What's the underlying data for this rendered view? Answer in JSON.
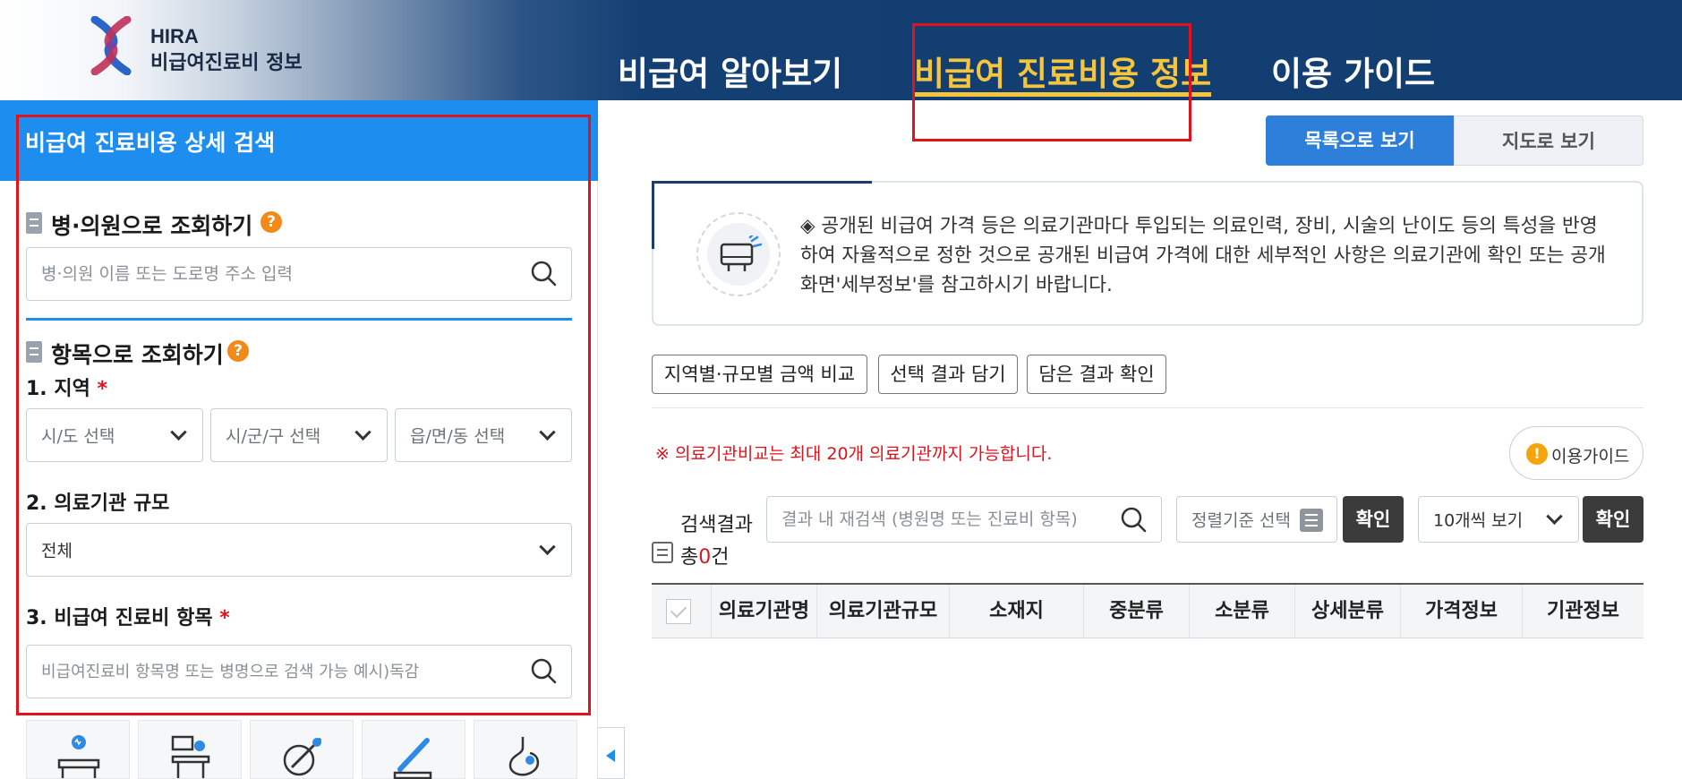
{
  "header": {
    "logo_line1": "HIRA",
    "logo_line2": "비급여진료비 정보",
    "nav": [
      "비급여 알아보기",
      "비급여 진료비용 정보",
      "이용 가이드"
    ],
    "active_nav_color": "#f5c53c"
  },
  "left_panel": {
    "title": "비급여 진료비용 상세 검색",
    "clinic_section": {
      "title": "병·의원으로 조회하기",
      "help": "?",
      "search_placeholder": "병·의원 이름 또는 도로명 주소 입력"
    },
    "item_section": {
      "title": "항목으로 조회하기",
      "help": "?",
      "region_label": "1. 지역",
      "required_mark": "*",
      "region_selects": [
        "시/도 선택",
        "시/군/구 선택",
        "읍/면/동 선택"
      ],
      "scale_label": "2. 의료기관 규모",
      "scale_value": "전체",
      "item_label": "3. 비급여 진료비 항목",
      "item_placeholder": "비급여진료비 항목명 또는 병명으로 검색 가능 예시)독감"
    },
    "category_icons": [
      "examination-bed-icon",
      "counseling-icon",
      "injection-icon",
      "surgery-icon",
      "stomach-icon"
    ]
  },
  "right": {
    "view_tabs": {
      "list": "목록으로 보기",
      "map": "지도로 보기"
    },
    "notice_text": "◈ 공개된 비급여 가격 등은 의료기관마다 투입되는 의료인력, 장비, 시술의 난이도 등의 특성을 반영하여 자율적으로 정한 것으로 공개된 비급여 가격에 대한 세부적인 사항은 의료기관에 확인 또는 공개화면'세부정보'를 참고하시기 바랍니다.",
    "actions": [
      "지역별·규모별 금액 비교",
      "선택 결과 담기",
      "담은 결과 확인"
    ],
    "warning": "※ 의료기관비교는 최대 20개 의료기관까지 가능합니다.",
    "guide_button": "이용가이드",
    "results_label": "검색결과",
    "total_prefix": "총",
    "total_count": "0",
    "total_suffix": "건",
    "research_placeholder": "결과 내 재검색 (병원명 또는 진료비 항목)",
    "sort_placeholder": "정렬기준 선택",
    "confirm": "확인",
    "page_size": "10개씩 보기",
    "columns": [
      "의료기관명",
      "의료기관규모",
      "소재지",
      "중분류",
      "소분류",
      "상세분류",
      "가격정보",
      "기관정보"
    ]
  },
  "colors": {
    "header_navy": "#123d70",
    "panel_blue": "#1e8df0",
    "highlight_red": "#e0121b"
  }
}
